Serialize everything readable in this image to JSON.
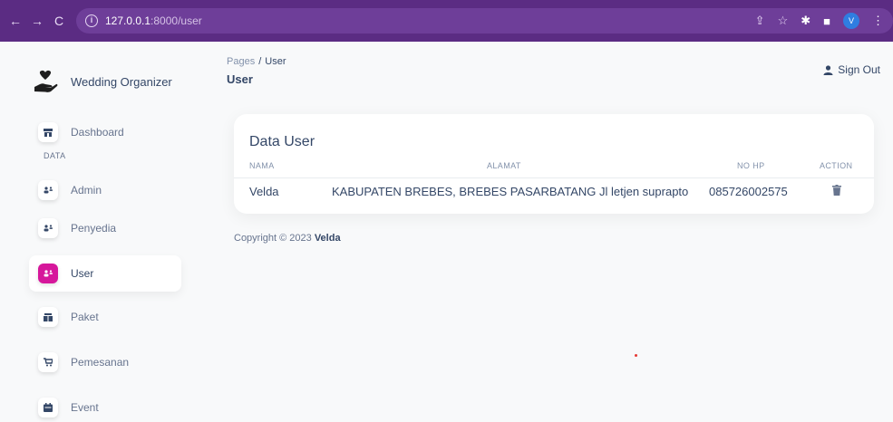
{
  "browser": {
    "url_host": "127.0.0.1",
    "url_path": ":8000/user",
    "profile_initial": "V"
  },
  "sidebar": {
    "brand": "Wedding Organizer",
    "section": "DATA",
    "items": [
      {
        "label": "Dashboard",
        "icon": "storefront-icon"
      },
      {
        "label": "Admin",
        "icon": "users-icon"
      },
      {
        "label": "Penyedia",
        "icon": "users-icon"
      },
      {
        "label": "User",
        "icon": "users-icon"
      },
      {
        "label": "Paket",
        "icon": "package-icon"
      },
      {
        "label": "Pemesanan",
        "icon": "cart-icon"
      },
      {
        "label": "Event",
        "icon": "calendar-icon"
      }
    ],
    "active": "User"
  },
  "header": {
    "breadcrumb_root": "Pages",
    "breadcrumb_sep": "/",
    "breadcrumb_current": "User",
    "title": "User",
    "signout": "Sign Out"
  },
  "table": {
    "title": "Data User",
    "columns": [
      "NAMA",
      "ALAMAT",
      "NO HP",
      "ACTION"
    ],
    "rows": [
      {
        "nama": "Velda",
        "alamat": "KABUPATEN BREBES, BREBES PASARBATANG Jl letjen suprapto",
        "no_hp": "085726002575",
        "action": "trash-icon"
      }
    ]
  },
  "footer": {
    "copyright": "Copyright © 2023",
    "author": "Velda"
  },
  "colors": {
    "browser_bar": "#5b2c83",
    "accent": "#d6179b",
    "text": "#344767"
  }
}
